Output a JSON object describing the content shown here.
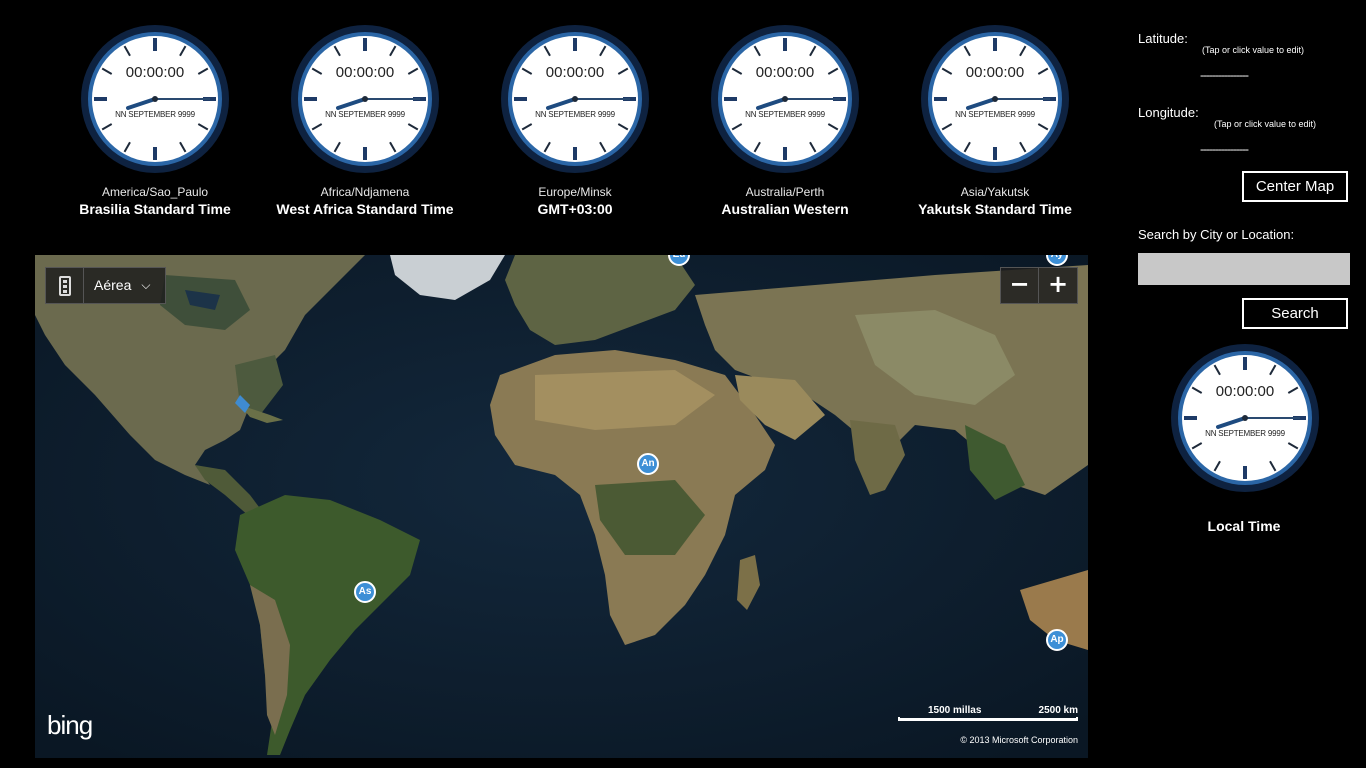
{
  "clocks": [
    {
      "time": "00:00:00",
      "date": "NN SEPTEMBER 9999",
      "zone": "America/Sao_Paulo",
      "name": "Brasilia Standard Time"
    },
    {
      "time": "00:00:00",
      "date": "NN SEPTEMBER 9999",
      "zone": "Africa/Ndjamena",
      "name": "West Africa Standard Time"
    },
    {
      "time": "00:00:00",
      "date": "NN SEPTEMBER 9999",
      "zone": "Europe/Minsk",
      "name": "GMT+03:00"
    },
    {
      "time": "00:00:00",
      "date": "NN SEPTEMBER 9999",
      "zone": "Australia/Perth",
      "name": "Australian Western"
    },
    {
      "time": "00:00:00",
      "date": "NN SEPTEMBER 9999",
      "zone": "Asia/Yakutsk",
      "name": "Yakutsk Standard Time"
    }
  ],
  "map": {
    "type_label": "Aérea",
    "zoom_out": "−",
    "zoom_in": "+",
    "pins": [
      {
        "label": "An"
      },
      {
        "label": "As"
      },
      {
        "label": "Ap"
      },
      {
        "label": "Eu"
      },
      {
        "label": "Ay"
      }
    ],
    "logo": "bing",
    "scale_miles": "1500 millas",
    "scale_km": "2500 km",
    "copyright": "© 2013 Microsoft Corporation"
  },
  "panel": {
    "latitude_label": "Latitude:",
    "latitude_hint": "(Tap or click value to edit)",
    "latitude_value": "----------------",
    "longitude_label": "Longitude:",
    "longitude_hint": "(Tap or click value to edit)",
    "longitude_value": "----------------",
    "center_map": "Center Map",
    "search_label": "Search by City or Location:",
    "search_value": "",
    "search_button": "Search"
  },
  "local_clock": {
    "time": "00:00:00",
    "date": "NN SEPTEMBER 9999",
    "label": "Local Time"
  },
  "colors": {
    "clock_ring": "#0e2240",
    "clock_rim": "#2b66a6",
    "clock_face": "#ffffff",
    "hand": "#1e4b80",
    "pin": "#3d8fd6"
  }
}
